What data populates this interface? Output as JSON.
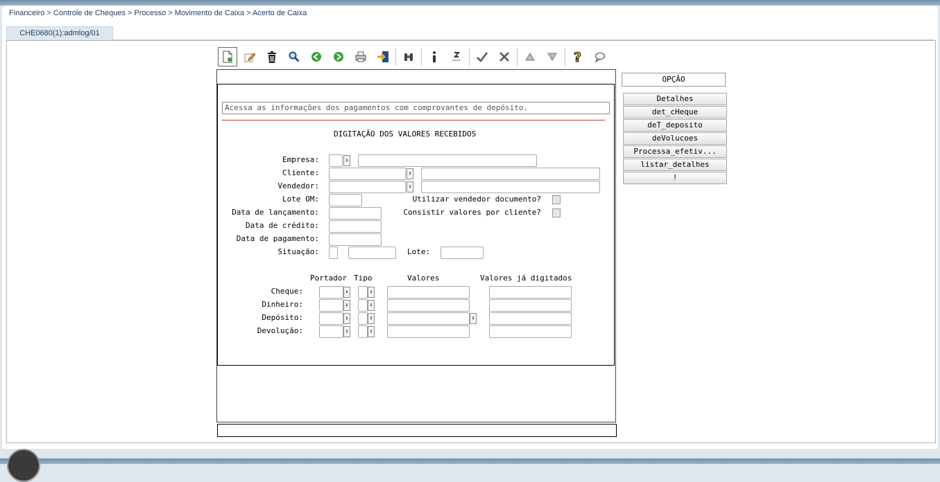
{
  "breadcrumb": "Financeiro > Controle de Cheques > Processo > Movimento de Caixa > Acerto de Caixa",
  "tab": {
    "label": "CHE0680(1):admlog/01"
  },
  "toolbar": {
    "icons": [
      "new-record-icon",
      "edit-icon",
      "delete-icon",
      "search-icon",
      "previous-icon",
      "next-icon",
      "print-icon",
      "exit-icon",
      "binoculars-icon",
      "info-icon",
      "sort-icon",
      "confirm-icon",
      "cancel-icon",
      "first-record-icon",
      "last-record-icon",
      "help-icon",
      "comment-icon"
    ]
  },
  "form": {
    "info_text": "Acessa as informações dos pagamentos com comprovantes de depósito.",
    "title": "DIGITAÇÃO DOS VALORES RECEBIDOS",
    "labels": {
      "empresa": "Empresa:",
      "cliente": "Cliente:",
      "vendedor": "Vendedor:",
      "lote_om": "Lote OM:",
      "data_lancamento": "Data de lançamento:",
      "data_credito": "Data de crédito:",
      "data_pagamento": "Data de pagamento:",
      "situacao": "Situação:",
      "lote": "Lote:",
      "utilizar_vendedor": "Utilizar vendedor documento?",
      "consistir_valores": "Consistir valores por cliente?"
    },
    "grid_headers": {
      "portador": "Portador",
      "tipo": "Tipo",
      "valores": "Valores",
      "valores_digitados": "Valores já digitados"
    },
    "grid_rows": {
      "cheque": "Cheque:",
      "dinheiro": "Dinheiro:",
      "deposito": "Depósito:",
      "devolucao": "Devolução:"
    }
  },
  "side": {
    "opcao": "OPÇÃO",
    "buttons": {
      "detalhes": "Detalhes",
      "det_cheque": "det_cHeque",
      "det_deposito": "deT_deposito",
      "devolucoes": "deVolucoes",
      "processa": "Processa_efetiv...",
      "listar": "listar_detalhes",
      "excl": "!"
    }
  }
}
